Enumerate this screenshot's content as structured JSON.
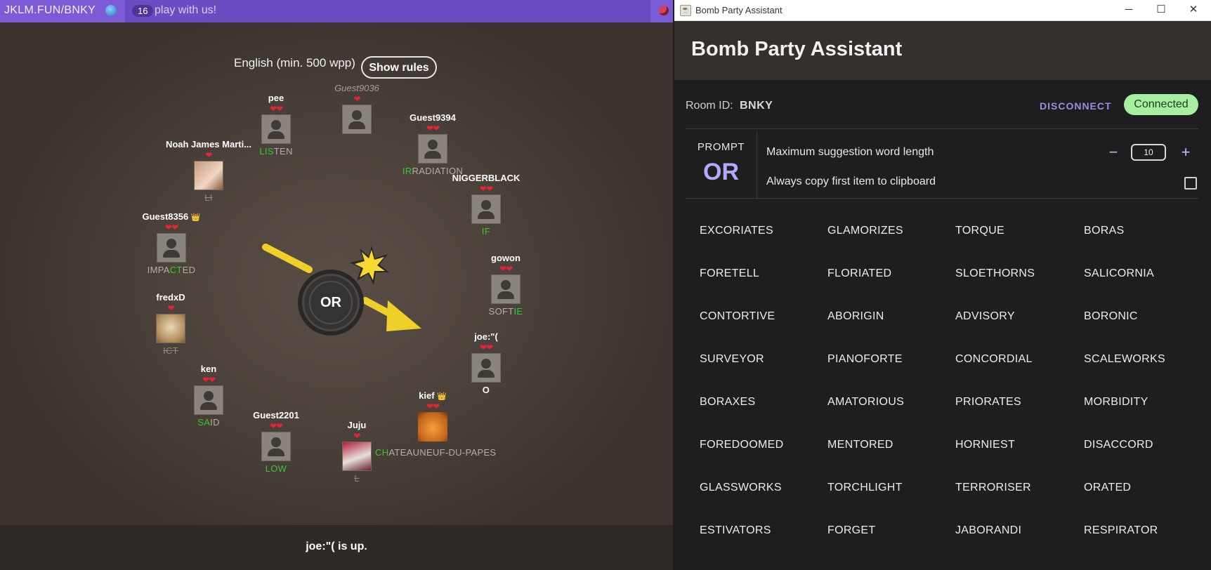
{
  "game": {
    "topbar": {
      "url": "JKLM.FUN/BNKY",
      "online_count": "16",
      "chat_placeholder": "play with us!"
    },
    "language": "English (min. 500 wpp)",
    "show_rules": "Show rules",
    "bomb_prompt": "OR",
    "status_text": "joe:\"( is up.",
    "players": [
      {
        "name": "pee",
        "hearts": "❤❤",
        "word_hl": "LIS",
        "word_rest": "TEN"
      },
      {
        "name": "Guest9036",
        "hearts": "❤",
        "ghost": true
      },
      {
        "name": "Guest9394",
        "hearts": "❤❤",
        "word_hl": "IR",
        "word_rest": "RADIATION"
      },
      {
        "name": "Noah James Marti...",
        "hearts": "❤",
        "word": "LI"
      },
      {
        "name": "NIGGERBLACK",
        "hearts": "❤❤",
        "word_hl": "IF",
        "word_rest": ""
      },
      {
        "name": "Guest8356",
        "crown": "👑",
        "hearts": "❤❤",
        "word_pre": "IMPA",
        "word_hl": "CT",
        "word_rest": "ED"
      },
      {
        "name": "gowon",
        "hearts": "❤❤",
        "word_pre": "SOFT",
        "word_hl": "IE",
        "word_rest": ""
      },
      {
        "name": "fredxD",
        "hearts": "❤",
        "word": "ICT"
      },
      {
        "name": "joe:\"(",
        "hearts": "❤❤",
        "word": "O"
      },
      {
        "name": "ken",
        "hearts": "❤❤",
        "word_hl": "SA",
        "word_rest": "ID"
      },
      {
        "name": "kief",
        "crown": "👑",
        "hearts": "❤❤",
        "word_hl": "CH",
        "word_rest": "ATEAUNEUF-DU-PAPES"
      },
      {
        "name": "Guest2201",
        "hearts": "❤❤",
        "word_hl": "LOW",
        "word_rest": ""
      },
      {
        "name": "Juju",
        "hearts": "❤",
        "word": "L"
      }
    ]
  },
  "app": {
    "window_title": "Bomb Party Assistant",
    "title": "Bomb Party Assistant",
    "room_label": "Room ID:",
    "room_id": "BNKY",
    "disconnect": "DISCONNECT",
    "connected": "Connected",
    "prompt_label": "PROMPT",
    "prompt_value": "OR",
    "max_len_label": "Maximum suggestion word length",
    "max_len_value": "10",
    "minus": "−",
    "plus": "+",
    "copy_label": "Always copy first item to clipboard",
    "words": [
      "EXCORIATES",
      "GLAMORIZES",
      "TORQUE",
      "BORAS",
      "FORETELL",
      "FLORIATED",
      "SLOETHORNS",
      "SALICORNIA",
      "CONTORTIVE",
      "ABORIGIN",
      "ADVISORY",
      "BORONIC",
      "SURVEYOR",
      "PIANOFORTE",
      "CONCORDIAL",
      "SCALEWORKS",
      "BORAXES",
      "AMATORIOUS",
      "PRIORATES",
      "MORBIDITY",
      "FOREDOOMED",
      "MENTORED",
      "HORNIEST",
      "DISACCORD",
      "GLASSWORKS",
      "TORCHLIGHT",
      "TERRORISER",
      "ORATED",
      "ESTIVATORS",
      "FORGET",
      "JABORANDI",
      "RESPIRATOR"
    ]
  },
  "colors": {
    "accent": "#7b5cd6",
    "highlight_green": "#36c932",
    "prompt_purple": "#b7a6ff",
    "connected_bg": "#a6efa0"
  },
  "icons": {
    "globe": "globe-icon",
    "mic": "mic-icon",
    "app": "app-icon",
    "heart": "heart-icon",
    "crown": "crown-icon"
  }
}
